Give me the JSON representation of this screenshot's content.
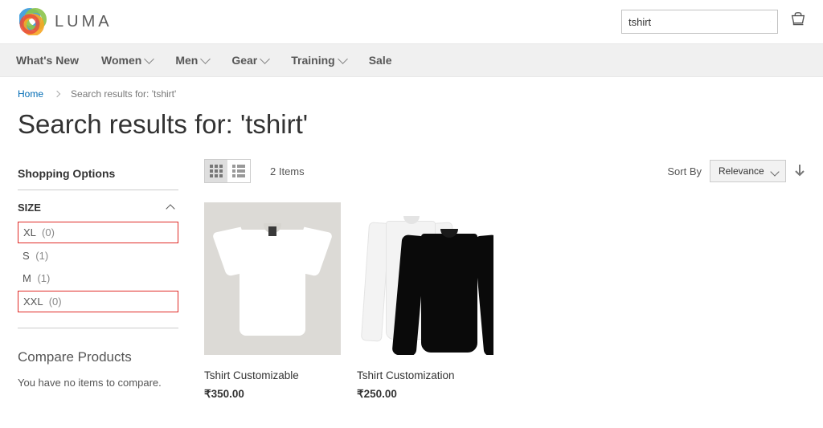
{
  "header": {
    "brand": "LUMA",
    "search_value": "tshirt"
  },
  "nav": [
    {
      "label": "What's New",
      "dropdown": false
    },
    {
      "label": "Women",
      "dropdown": true
    },
    {
      "label": "Men",
      "dropdown": true
    },
    {
      "label": "Gear",
      "dropdown": true
    },
    {
      "label": "Training",
      "dropdown": true
    },
    {
      "label": "Sale",
      "dropdown": false
    }
  ],
  "breadcrumbs": {
    "home": "Home",
    "current": "Search results for: 'tshirt'"
  },
  "page_title": "Search results for: 'tshirt'",
  "sidebar": {
    "shopping_options": "Shopping Options",
    "size_label": "SIZE",
    "sizes": [
      {
        "label": "XL",
        "count": "(0)",
        "highlight": true
      },
      {
        "label": "S",
        "count": "(1)",
        "highlight": false
      },
      {
        "label": "M",
        "count": "(1)",
        "highlight": false
      },
      {
        "label": "XXL",
        "count": "(0)",
        "highlight": true
      }
    ],
    "compare_title": "Compare Products",
    "compare_empty": "You have no items to compare."
  },
  "toolbar": {
    "item_count": "2 Items",
    "sort_by_label": "Sort By",
    "sort_value": "Relevance"
  },
  "products": [
    {
      "name": "Tshirt Customizable",
      "price": "₹350.00"
    },
    {
      "name": "Tshirt Customization",
      "price": "₹250.00"
    }
  ]
}
